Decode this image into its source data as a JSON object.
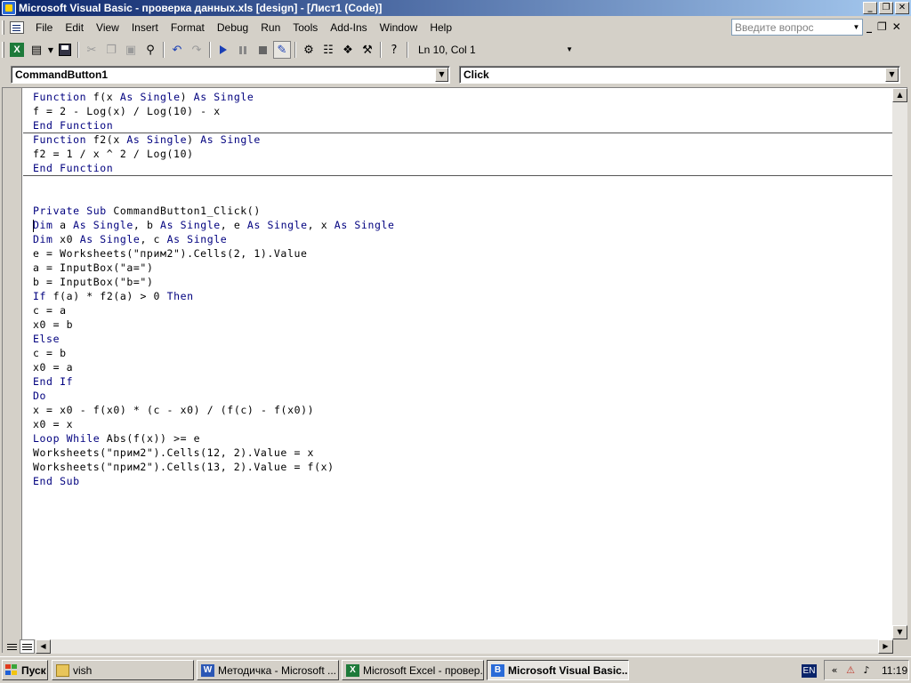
{
  "window": {
    "title": "Microsoft Visual Basic - проверка данных.xls [design] - [Лист1 (Code)]",
    "min_symbol": "_",
    "restore_symbol": "❐",
    "close_symbol": "✕"
  },
  "menu": {
    "items": [
      "File",
      "Edit",
      "View",
      "Insert",
      "Format",
      "Debug",
      "Run",
      "Tools",
      "Add-Ins",
      "Window",
      "Help"
    ],
    "ask_placeholder": "Введите вопрос"
  },
  "toolbar": {
    "position": "Ln 10, Col 1",
    "icons": [
      "excel-icon",
      "insert-module-icon",
      "save-icon",
      "cut-icon",
      "copy-icon",
      "paste-icon",
      "find-icon",
      "undo-icon",
      "redo-icon",
      "run-icon",
      "break-icon",
      "reset-icon",
      "design-mode-icon",
      "project-explorer-icon",
      "properties-icon",
      "object-browser-icon",
      "toolbox-icon",
      "help-icon"
    ]
  },
  "combos": {
    "object": "CommandButton1",
    "procedure": "Click"
  },
  "code": {
    "lines": [
      "Function f(x As Single) As Single",
      "f = 2 - Log(x) / Log(10) - x",
      "End Function",
      "Function f2(x As Single) As Single",
      "f2 = 1 / x ^ 2 / Log(10)",
      "End Function",
      "",
      "",
      "Private Sub CommandButton1_Click()",
      "Dim a As Single, b As Single, e As Single, x As Single",
      "Dim x0 As Single, c As Single",
      "e = Worksheets(\"прим2\").Cells(2, 1).Value",
      "a = InputBox(\"a=\")",
      "b = InputBox(\"b=\")",
      "If f(a) * f2(a) > 0 Then",
      "c = a",
      "x0 = b",
      "Else",
      "c = b",
      "x0 = a",
      "End If",
      "Do",
      "x = x0 - f(x0) * (c - x0) / (f(c) - f(x0))",
      "x0 = x",
      "Loop While Abs(f(x)) >= e",
      "Worksheets(\"прим2\").Cells(12, 2).Value = x",
      "Worksheets(\"прим2\").Cells(13, 2).Value = f(x)",
      "End Sub"
    ],
    "keywords": [
      "Function",
      "End",
      "As",
      "Single",
      "Private",
      "Sub",
      "Dim",
      "If",
      "Then",
      "Else",
      "Do",
      "Loop",
      "While"
    ],
    "keyword_color": "#00007f"
  },
  "taskbar": {
    "start": "Пуск",
    "tasks": [
      {
        "label": "vish",
        "icon": "folder-icon"
      },
      {
        "label": "Методичка - Microsoft ...",
        "icon": "word-icon"
      },
      {
        "label": "Microsoft Excel - провер...",
        "icon": "excel-icon"
      },
      {
        "label": "Microsoft Visual Basic...",
        "icon": "vba-icon",
        "active": true
      }
    ],
    "lang": "EN",
    "clock": "11:19",
    "chevron": "«"
  }
}
